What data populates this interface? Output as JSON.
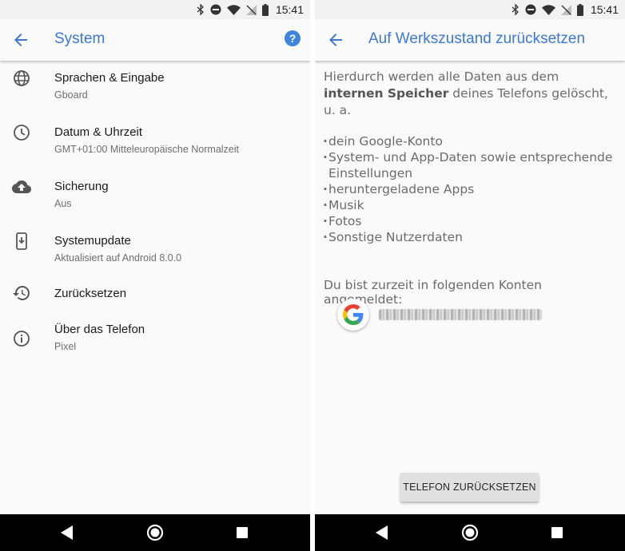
{
  "status_bar": {
    "time": "15:41"
  },
  "system_screen": {
    "title": "System",
    "help_label": "?",
    "items": [
      {
        "title": "Sprachen & Eingabe",
        "subtitle": "Gboard",
        "icon": "globe-icon"
      },
      {
        "title": "Datum & Uhrzeit",
        "subtitle": "GMT+01:00 Mitteleuropäische Normalzeit",
        "icon": "clock-icon"
      },
      {
        "title": "Sicherung",
        "subtitle": "Aus",
        "icon": "cloud-upload-icon"
      },
      {
        "title": "Systemupdate",
        "subtitle": "Aktualisiert auf Android 8.0.0",
        "icon": "system-update-icon"
      },
      {
        "title": "Zurücksetzen",
        "subtitle": "",
        "icon": "restore-icon"
      },
      {
        "title": "Über das Telefon",
        "subtitle": "Pixel",
        "icon": "info-icon"
      }
    ]
  },
  "reset_screen": {
    "title": "Auf Werkszustand zurücksetzen",
    "intro_before": "Hierdurch werden alle Daten aus dem ",
    "intro_bold": "internen Speicher",
    "intro_after": " deines Telefons gelöscht, u. a.",
    "bullets": [
      "dein Google-Konto",
      "System- und App-Daten sowie entsprechende Einstellungen",
      "heruntergeladene Apps",
      "Musik",
      "Fotos",
      "Sonstige Nutzerdaten"
    ],
    "accounts_label": "Du bist zurzeit in folgenden Konten angemeldet:",
    "account_icon": "google-logo-icon",
    "reset_button": "TELEFON ZURÜCKSETZEN"
  },
  "colors": {
    "accent": "#3b78d8",
    "help_bg": "#3d86df",
    "navbar": "#000000"
  }
}
